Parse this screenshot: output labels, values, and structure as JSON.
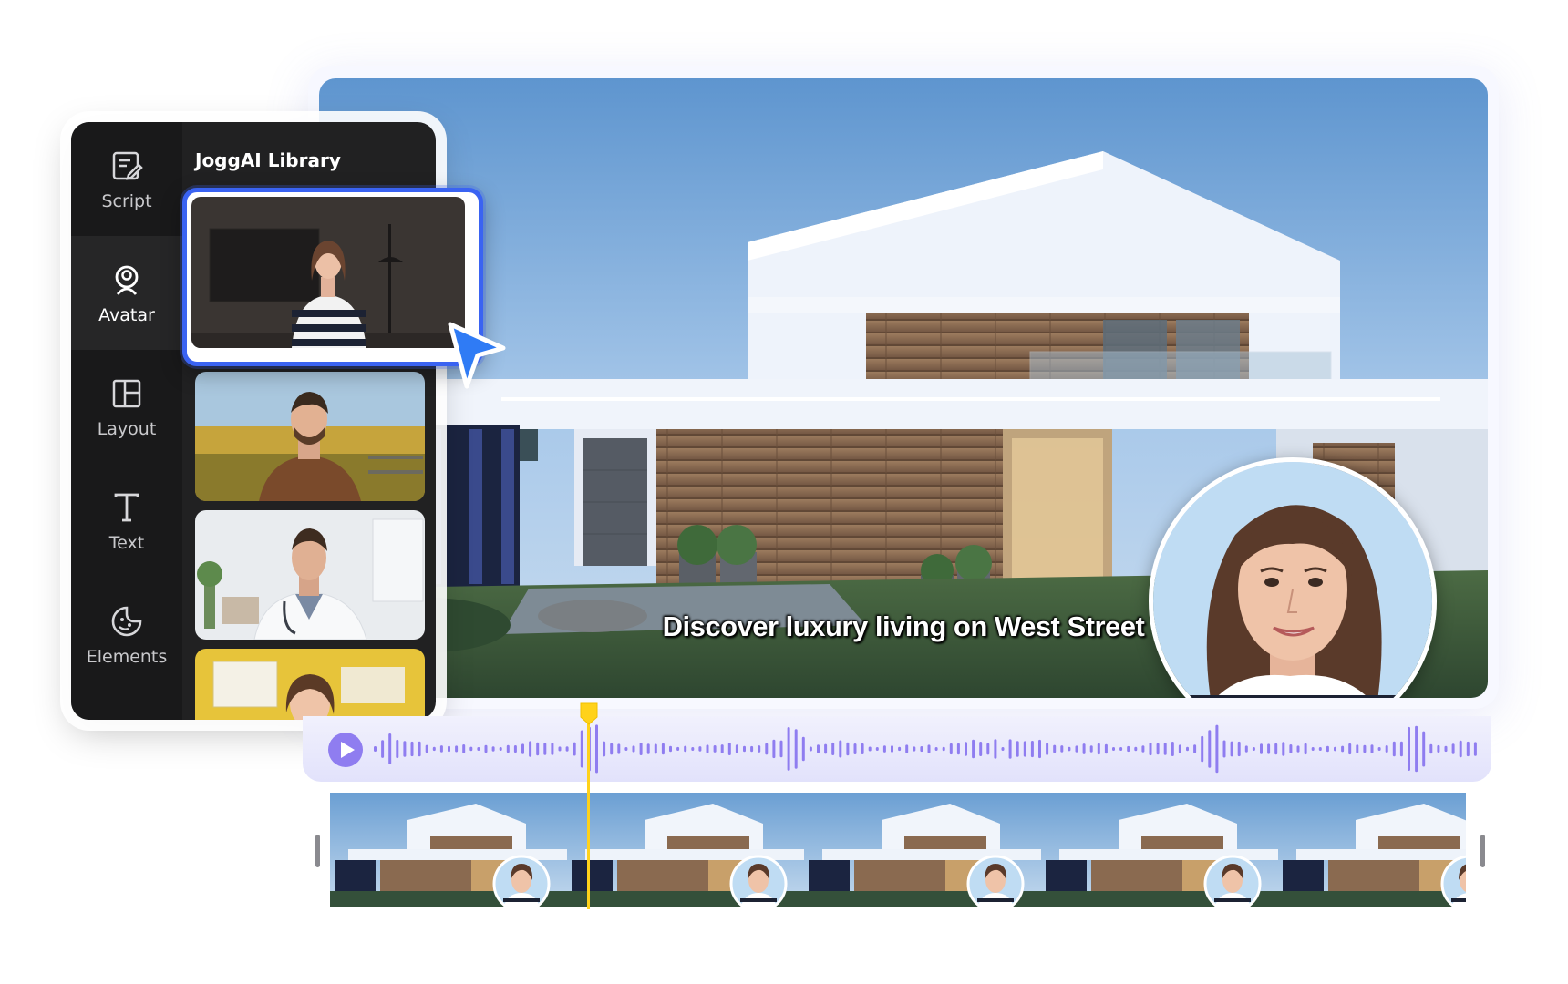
{
  "sidebar": {
    "items": [
      {
        "label": "Script",
        "icon": "script-icon"
      },
      {
        "label": "Avatar",
        "icon": "avatar-icon"
      },
      {
        "label": "Layout",
        "icon": "layout-icon"
      },
      {
        "label": "Text",
        "icon": "text-icon"
      },
      {
        "label": "Elements",
        "icon": "elements-icon"
      }
    ],
    "active": "Avatar"
  },
  "library": {
    "title": "JoggAI Library",
    "thumbnails": [
      {
        "subject": "woman in striped top, dark room",
        "selected": true
      },
      {
        "subject": "man in brown jacket, flower field"
      },
      {
        "subject": "doctor with stethoscope"
      },
      {
        "subject": "woman, yellow classroom"
      }
    ]
  },
  "preview": {
    "subtitle": "Discover luxury living on West Street"
  },
  "timeline": {
    "frame_count": 5
  },
  "colors": {
    "accent_blue": "#3a63f2",
    "wave_purple": "#8f7df0",
    "playhead_yellow": "#ffd21a",
    "panel_dark": "#212122"
  }
}
